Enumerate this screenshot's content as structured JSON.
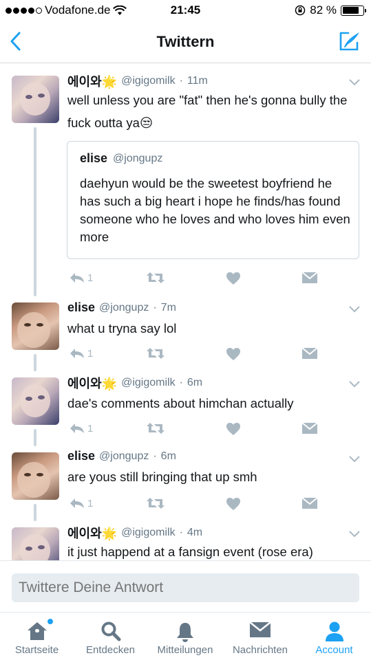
{
  "status_bar": {
    "carrier": "Vodafone.de",
    "time": "21:45",
    "battery": "82 %",
    "battery_level": 0.82
  },
  "nav": {
    "title": "Twittern",
    "back_icon": "chevron-left-icon",
    "compose_icon": "compose-icon"
  },
  "tweets": [
    {
      "name": "에이와🌟",
      "handle": "@igigomilk",
      "time": "11m",
      "text": "well unless you are \"fat\" then he's gonna bully the fuck outta ya😒",
      "reply_count": "1",
      "quote": {
        "name": "elise",
        "handle": "@jongupz",
        "text": "daehyun would be the sweetest boyfriend he has such a big heart i hope he finds/has found someone who he loves and who loves him even more"
      }
    },
    {
      "name": "elise",
      "handle": "@jongupz",
      "time": "7m",
      "text": "what u tryna say lol",
      "reply_count": "1"
    },
    {
      "name": "에이와🌟",
      "handle": "@igigomilk",
      "time": "6m",
      "text": "dae's comments about himchan actually",
      "reply_count": "1"
    },
    {
      "name": "elise",
      "handle": "@jongupz",
      "time": "6m",
      "text": "are yous still bringing that up smh",
      "reply_count": "1"
    },
    {
      "name": "에이와🌟",
      "handle": "@igigomilk",
      "time": "4m",
      "text": "it just happend at a fansign event (rose era)"
    }
  ],
  "reply": {
    "placeholder": "Twittere Deine Antwort"
  },
  "tabs": [
    {
      "label": "Startseite",
      "icon": "home-icon"
    },
    {
      "label": "Entdecken",
      "icon": "search-icon"
    },
    {
      "label": "Mitteilungen",
      "icon": "bell-icon"
    },
    {
      "label": "Nachrichten",
      "icon": "envelope-icon"
    },
    {
      "label": "Account",
      "icon": "person-icon",
      "active": true
    }
  ],
  "colors": {
    "accent": "#1da1f2",
    "icon_gray": "#aab8c2",
    "secondary_text": "#657786",
    "divider": "#ccd6dd"
  }
}
